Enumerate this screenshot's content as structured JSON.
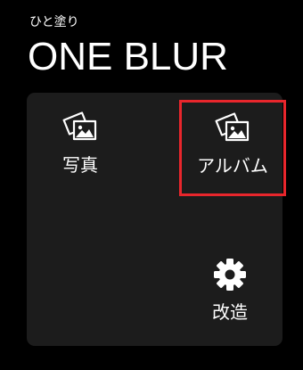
{
  "header": {
    "subtitle": "ひと塗り",
    "title": "ONE BLUR"
  },
  "menu": {
    "photo": {
      "label": "写真",
      "icon": "photo-icon"
    },
    "album": {
      "label": "アルバム",
      "icon": "album-icon",
      "highlight_color": "#e8262c"
    },
    "settings": {
      "label": "改造",
      "icon": "gear-icon"
    }
  },
  "colors": {
    "background": "#000000",
    "panel": "#1c1c1c",
    "text": "#ffffff",
    "highlight": "#e8262c"
  }
}
